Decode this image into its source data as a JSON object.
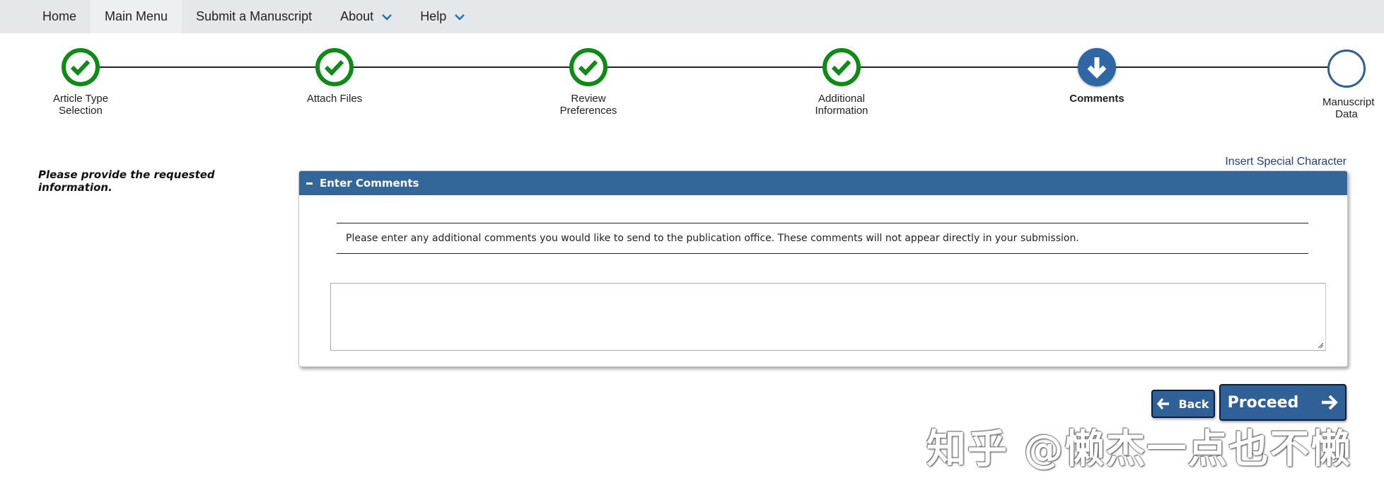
{
  "nav": {
    "items": [
      {
        "label": "Home"
      },
      {
        "label": "Main Menu"
      },
      {
        "label": "Submit a Manuscript"
      },
      {
        "label": "About"
      },
      {
        "label": "Help"
      }
    ]
  },
  "progress": {
    "steps": [
      {
        "label": "Article Type Selection",
        "state": "done"
      },
      {
        "label": "Attach Files",
        "state": "done"
      },
      {
        "label": "Review Preferences",
        "state": "done"
      },
      {
        "label": "Additional Information",
        "state": "done"
      },
      {
        "label": "Comments",
        "state": "current"
      },
      {
        "label": "Manuscript Data",
        "state": "todo"
      }
    ]
  },
  "instruction": "Please provide the requested information.",
  "special_char_link": "Insert Special Character",
  "panel": {
    "title": "Enter Comments",
    "message": "Please enter any additional comments you would like to send to the publication office. These comments will not appear directly in your submission.",
    "comment_value": ""
  },
  "buttons": {
    "back": "Back",
    "proceed": "Proceed"
  },
  "watermark": "知乎 @懒杰一点也不懒",
  "colors": {
    "done": "#0e8a16",
    "current": "#2f66a4",
    "panel_header": "#336699",
    "button": "#2f6098"
  }
}
